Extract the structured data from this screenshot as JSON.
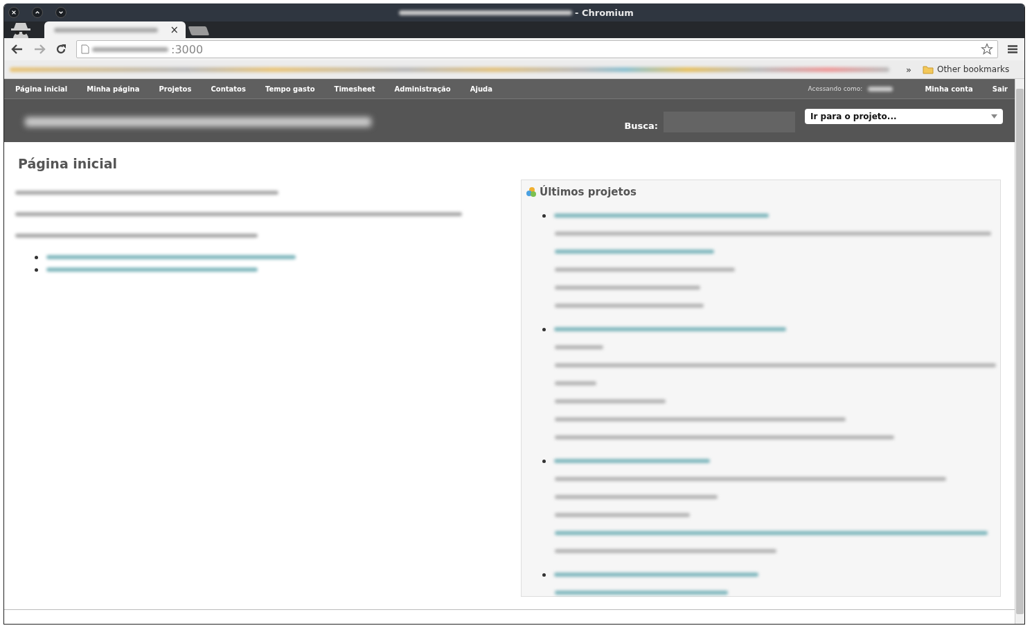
{
  "window": {
    "title_suffix": "- Chromium"
  },
  "tab": {
    "close": "×"
  },
  "address_bar": {
    "value": ":3000"
  },
  "bookmarks_bar": {
    "overflow": "»",
    "other": "Other bookmarks"
  },
  "top_menu": {
    "items": [
      {
        "label": "Página inicial"
      },
      {
        "label": "Minha página"
      },
      {
        "label": "Projetos"
      },
      {
        "label": "Contatos"
      },
      {
        "label": "Tempo gasto"
      },
      {
        "label": "Timesheet"
      },
      {
        "label": "Administração"
      },
      {
        "label": "Ajuda"
      }
    ],
    "logged_as": "Acessando como:",
    "account_links": [
      {
        "label": "Minha conta"
      },
      {
        "label": "Sair"
      }
    ]
  },
  "header": {
    "search_label": "Busca:",
    "project_jump": "Ir para o projeto..."
  },
  "content": {
    "title": "Página inicial",
    "block_title": "Últimos projetos"
  }
}
